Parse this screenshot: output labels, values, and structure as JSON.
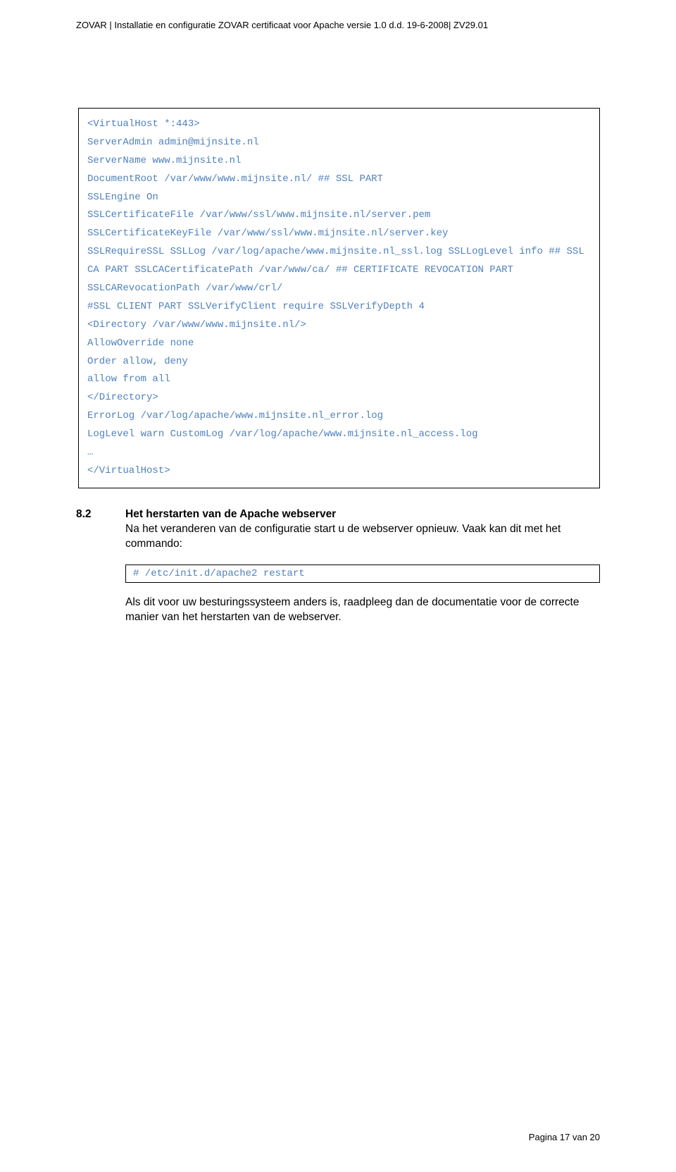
{
  "header": {
    "text": "ZOVAR | Installatie en configuratie ZOVAR certificaat voor Apache versie 1.0 d.d. 19-6-2008| ZV29.01"
  },
  "code_block": {
    "lines": [
      "<VirtualHost *:443>",
      "ServerAdmin admin@mijnsite.nl",
      "ServerName www.mijnsite.nl",
      "DocumentRoot /var/www/www.mijnsite.nl/ ## SSL PART",
      "SSLEngine On",
      "SSLCertificateFile /var/www/ssl/www.mijnsite.nl/server.pem",
      "SSLCertificateKeyFile /var/www/ssl/www.mijnsite.nl/server.key",
      "SSLRequireSSL SSLLog /var/log/apache/www.mijnsite.nl_ssl.log SSLLogLevel info ## SSL CA PART SSLCACertificatePath /var/www/ca/ ## CERTIFICATE REVOCATION PART",
      "SSLCARevocationPath /var/www/crl/",
      "#SSL CLIENT PART SSLVerifyClient require SSLVerifyDepth 4",
      "<Directory /var/www/www.mijnsite.nl/>",
      "AllowOverride none",
      "Order allow, deny",
      "allow from all",
      "</Directory>",
      "ErrorLog /var/log/apache/www.mijnsite.nl_error.log",
      "LogLevel warn CustomLog /var/log/apache/www.mijnsite.nl_access.log",
      "…",
      "</VirtualHost>"
    ]
  },
  "section": {
    "number": "8.2",
    "title": "Het herstarten van de Apache webserver",
    "text": "Na het veranderen van de configuratie start u de webserver opnieuw. Vaak kan dit met het commando:"
  },
  "command_block": {
    "text": "# /etc/init.d/apache2 restart"
  },
  "paragraph": {
    "text": "Als dit voor uw besturingssysteem anders is, raadpleeg dan de documentatie voor de correcte manier van het herstarten van de webserver."
  },
  "footer": {
    "text": "Pagina 17 van 20"
  }
}
